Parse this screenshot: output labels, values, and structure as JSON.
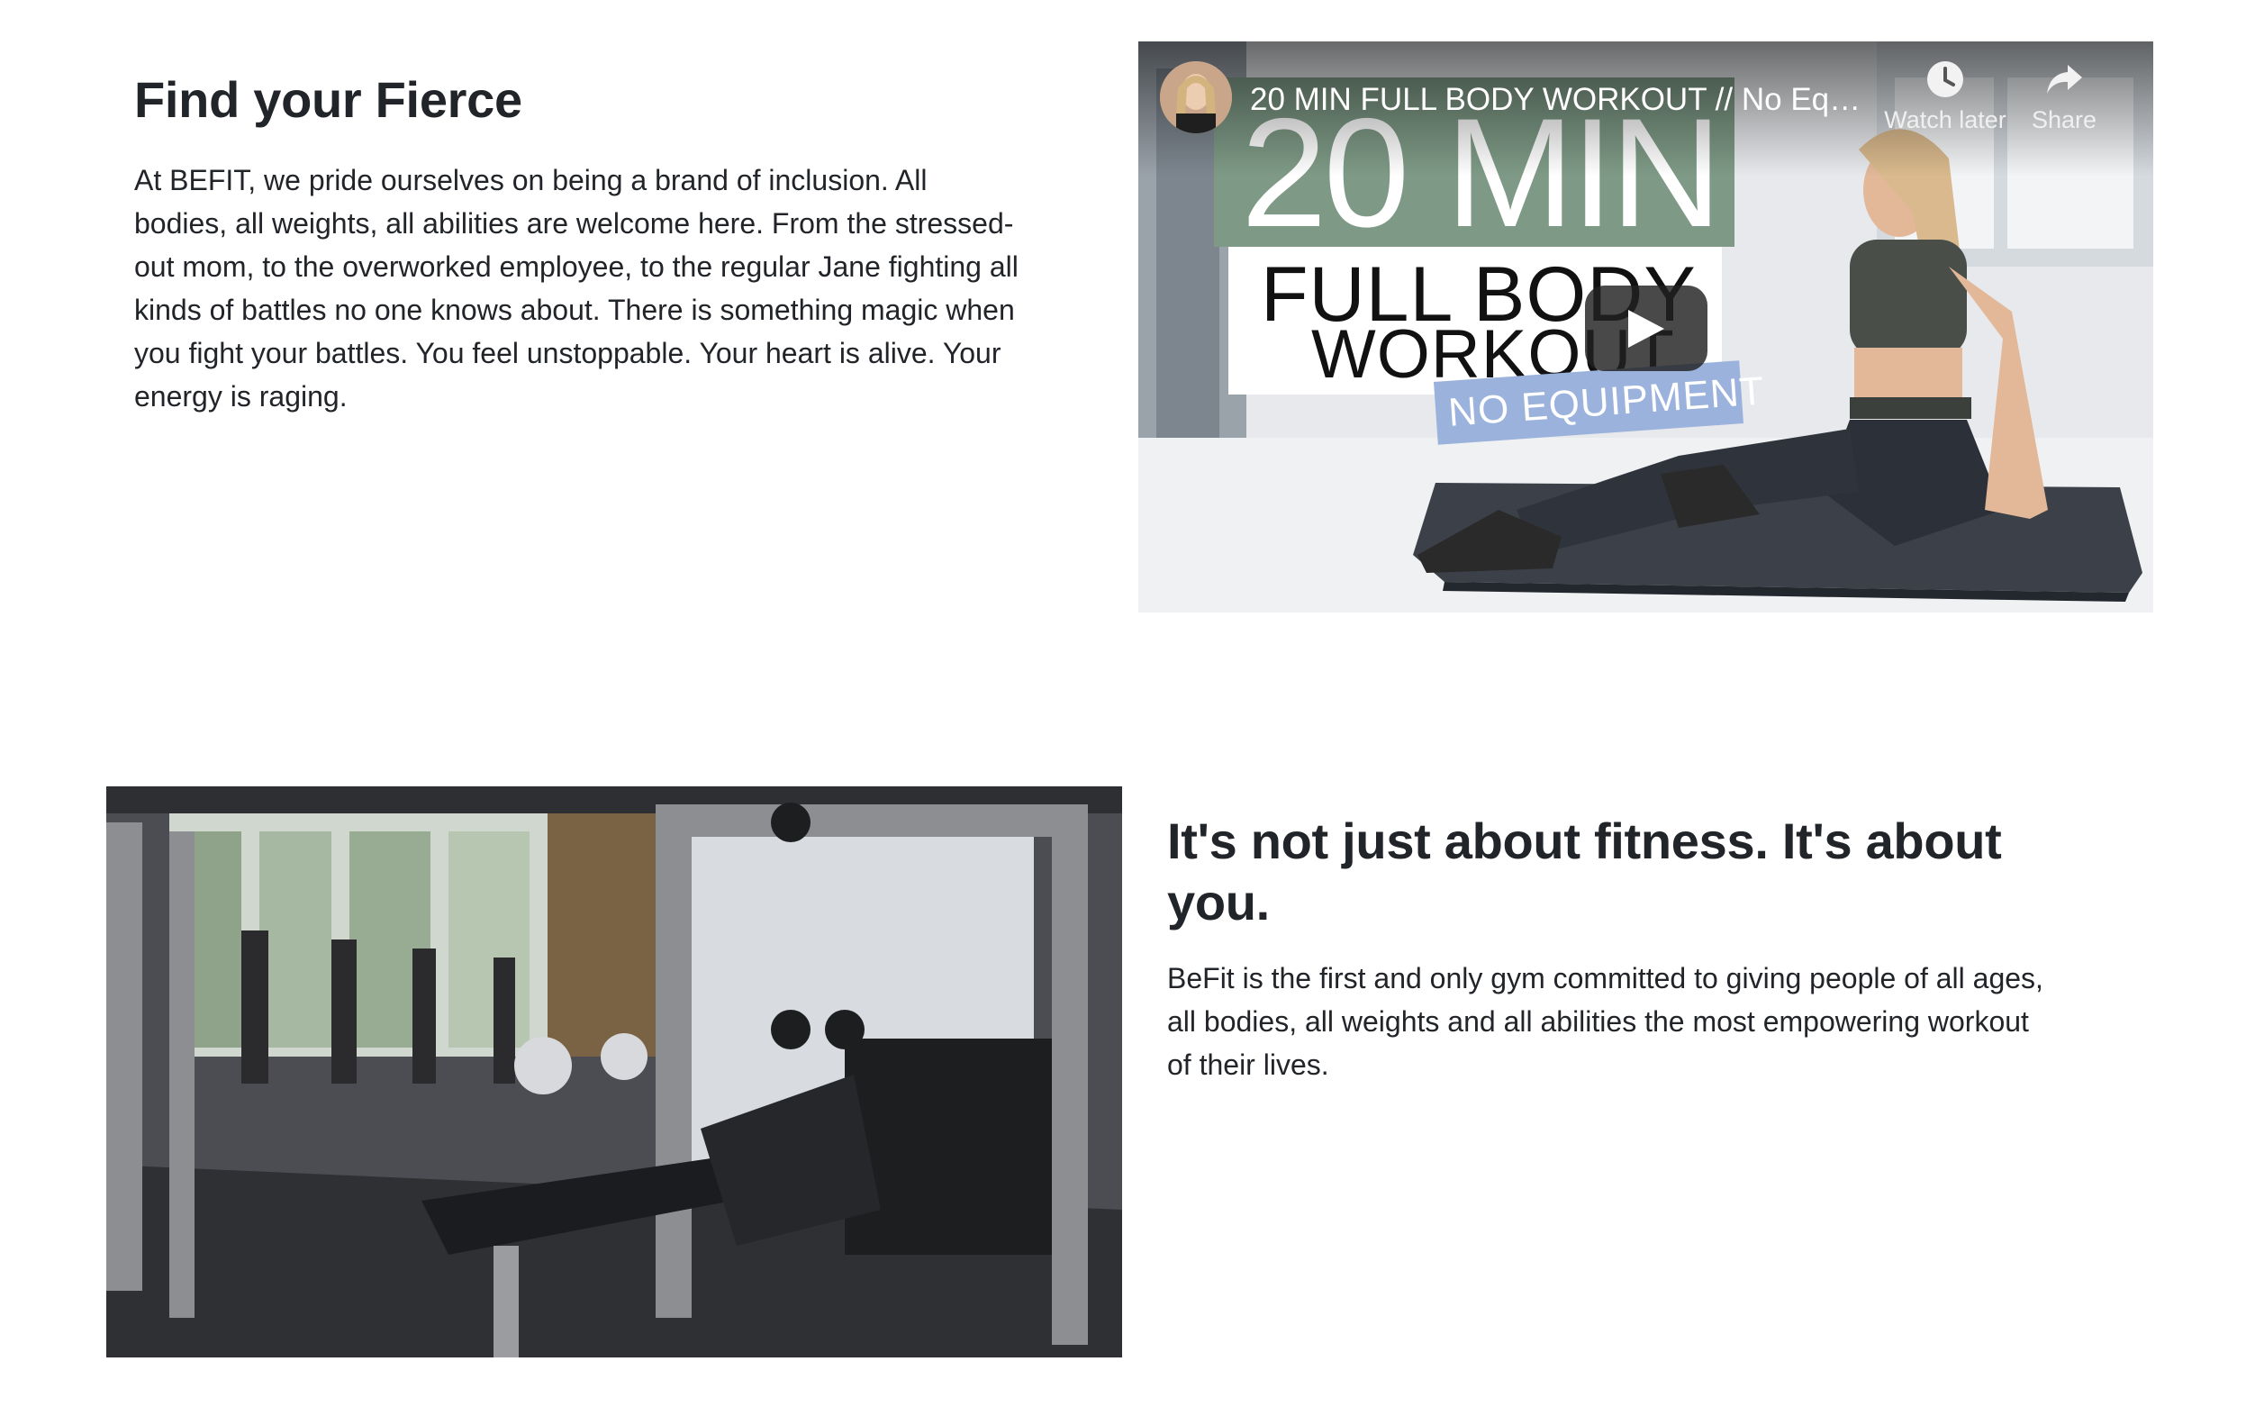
{
  "section_one": {
    "heading": "Find your Fierce",
    "body": "At BEFIT, we pride ourselves on being a brand of inclusion. All bodies, all weights, all abilities are welcome here. From the stressed-out mom, to the overworked employee, to the regular Jane fighting all kinds of battles no one knows about. There is something magic when you fight your battles. You feel unstoppable. Your heart is alive. Your energy is raging."
  },
  "video": {
    "title": "20 MIN FULL BODY WORKOUT // No Equ...",
    "watch_later_label": "Watch later",
    "share_label": "Share",
    "thumbnail": {
      "line1": "20 MIN",
      "line2": "FULL BODY",
      "line3": "WORKOUT",
      "line4": "NO EQUIPMENT",
      "green": "#7e9a86",
      "blue": "#9bb3dc"
    }
  },
  "section_two": {
    "heading": "It's not just about fitness. It's about you.",
    "body": "BeFit is the first and only gym committed to giving people of all ages, all bodies, all weights and all abilities the most empowering workout of their lives."
  }
}
